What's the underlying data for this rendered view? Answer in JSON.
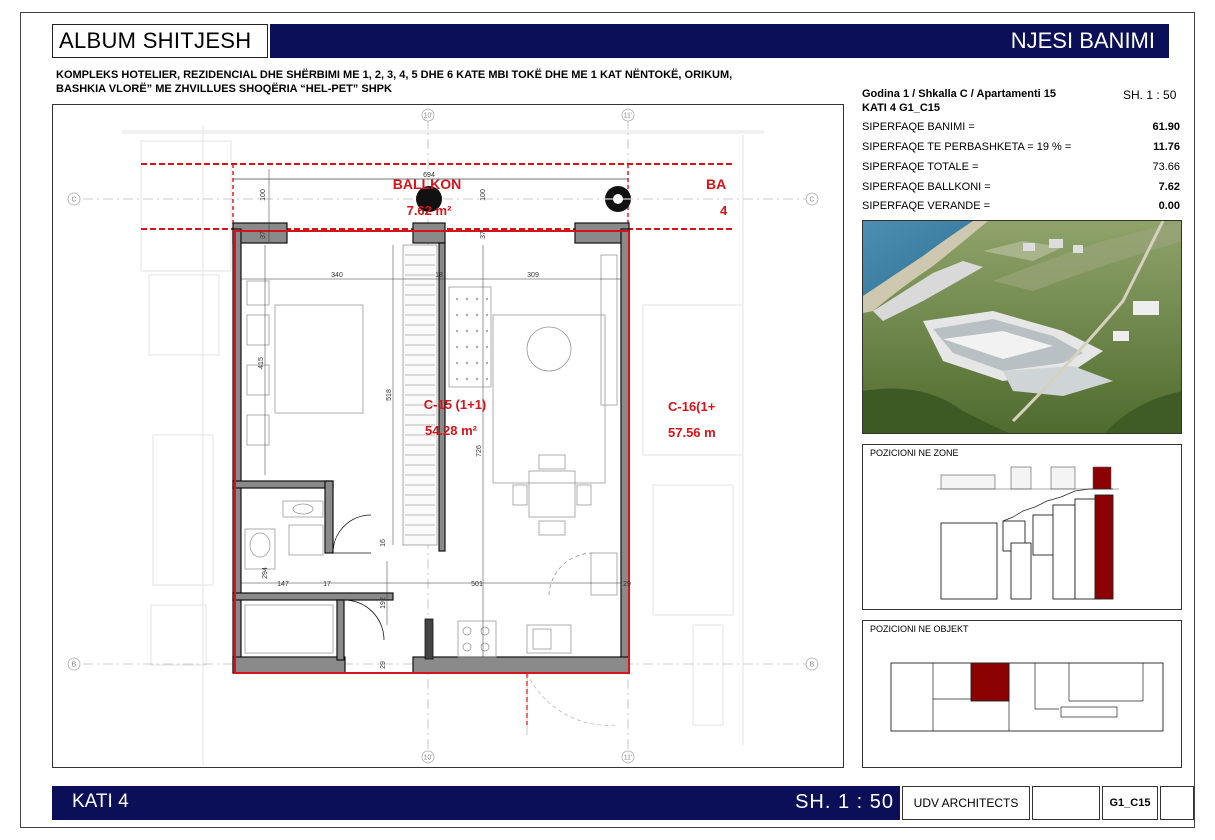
{
  "header": {
    "album_title": "ALBUM SHITJESH",
    "section_title": "NJESI BANIMI"
  },
  "project": {
    "line1": "KOMPLEKS HOTELIER, REZIDENCIAL DHE SHËRBIMI ME 1, 2, 3, 4, 5 DHE 6 KATE MBI TOKË DHE ME 1 KAT NËNTOKË, ORIKUM,",
    "line2": "BASHKIA VLORË” ME ZHVILLUES SHOQËRIA “HEL-PET” SHPK"
  },
  "unit": {
    "location": "Godina 1 / Shkalla C / Apartamenti 15",
    "scale": "SH.  1 : 50",
    "floor_code": "KATI 4 G1_C15",
    "areas": [
      {
        "label": "SIPERFAQE BANIMI =",
        "value": "61.90",
        "bold": true
      },
      {
        "label": "SIPERFAQE TE PERBASHKETA = 19 % =",
        "value": "11.76",
        "bold": true
      },
      {
        "label": "SIPERFAQE TOTALE =",
        "value": "73.66",
        "bold": false
      },
      {
        "label": "SIPERFAQE BALLKONI =",
        "value": "7.62",
        "bold": true
      },
      {
        "label": "SIPERFAQE VERANDE =",
        "value": "0.00",
        "bold": true
      }
    ]
  },
  "plan": {
    "balcony_label": "BALLKON",
    "balcony_area": "7.62 m²",
    "neighbor_balcony_label": "BA",
    "neighbor_balcony_area": "4",
    "unit_label": "C-15 (1+1)",
    "unit_area": "54.28 m²",
    "neighbor_unit_label": "C-16(1+",
    "neighbor_unit_area": "57.56 m",
    "grid_axes": {
      "c": "C",
      "b": "B",
      "x1": "10'",
      "x2": "11'"
    },
    "dimensions": {
      "d_top": "694",
      "d_100a": "100",
      "d_100b": "100",
      "d_37a": "37",
      "d_37b": "37",
      "d_340": "340",
      "d_309": "309",
      "d_415": "415",
      "d_518": "518",
      "d_726": "726",
      "d_16": "16",
      "d_294": "294",
      "d_147": "147",
      "d_17": "17",
      "d_501": "501",
      "d_192": "192",
      "d_29": "29",
      "d_29b": "29",
      "d_18": "18"
    }
  },
  "zone_map": {
    "label": "POZICIONI NE ZONE"
  },
  "object_map": {
    "label": "POZICIONI NE OBJEKT"
  },
  "footer": {
    "floor": "KATI 4",
    "scale": "SH.   1 : 50",
    "architect": "UDV ARCHITECTS",
    "blank": "",
    "code": "G1_C15"
  },
  "colors": {
    "navy": "#0a0f57",
    "highlight": "#8b0000",
    "plan_red": "#d4141a"
  }
}
